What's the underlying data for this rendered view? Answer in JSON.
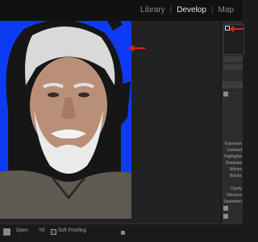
{
  "header": {
    "modules": [
      "Library",
      "Develop",
      "Map"
    ],
    "separator": "|",
    "active": "Develop"
  },
  "right_panel": {
    "labels": [
      "Exposure",
      "Contrast",
      "Highlights",
      "Shadows",
      "Whites",
      "Blacks",
      "Clarity",
      "Vibrance",
      "Saturation"
    ]
  },
  "toolbar": {
    "soft_proofing": "Soft Proofing",
    "before_after": "Open",
    "menu": "YE"
  },
  "colors": {
    "clipping_blue": "#0d3bf4",
    "arrow_red": "#e02020"
  },
  "icons": [
    "red-arrow-icon",
    "loupe-view-icon",
    "clipping-indicator-icon",
    "spot-removal-icon"
  ]
}
